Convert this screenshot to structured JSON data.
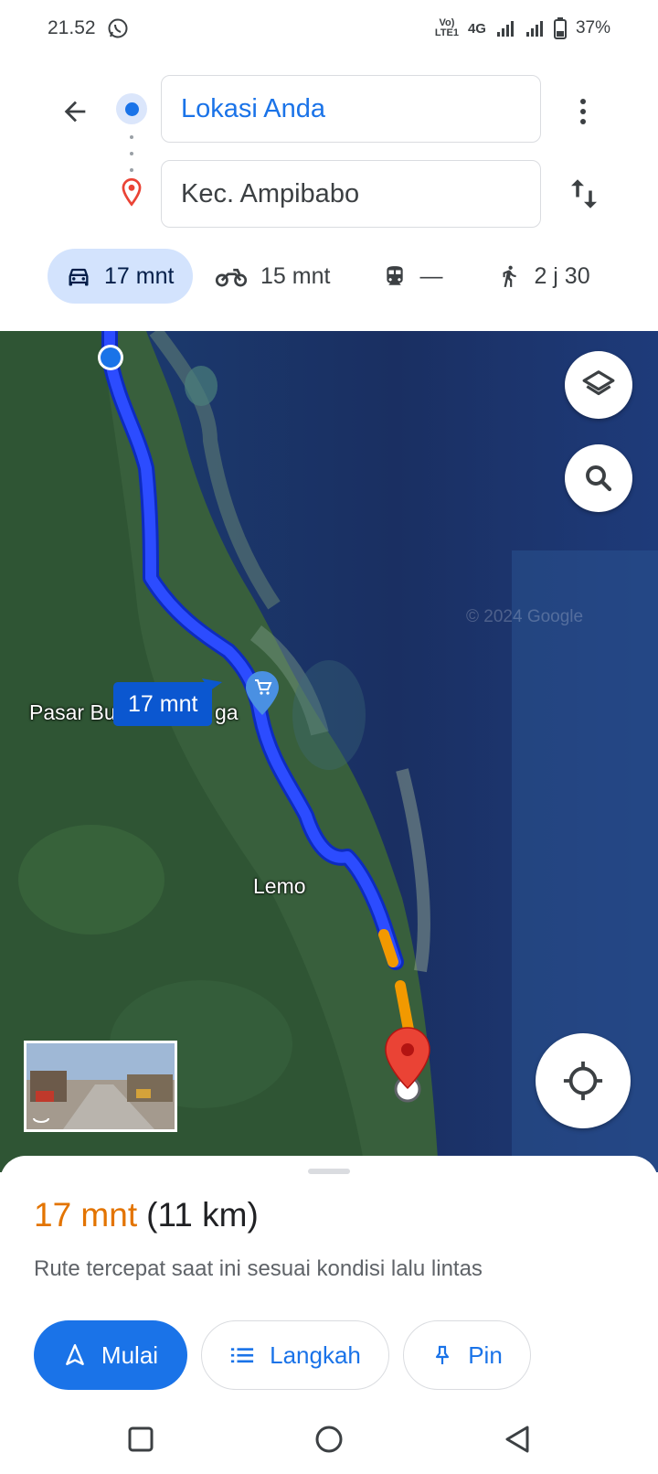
{
  "status_bar": {
    "time": "21.52",
    "network_label_top": "Vo)",
    "network_label_bottom": "LTE1",
    "network_type": "4G",
    "battery_percent": "37%"
  },
  "header": {
    "origin_value": "Lokasi Anda",
    "destination_value": "Kec. Ampibabo"
  },
  "modes": [
    {
      "name": "car",
      "label": "17 mnt",
      "active": true
    },
    {
      "name": "motorcycle",
      "label": "15 mnt",
      "active": false
    },
    {
      "name": "transit",
      "label": "—",
      "active": false
    },
    {
      "name": "walk",
      "label": "2 j 30",
      "active": false
    }
  ],
  "map": {
    "route_badge": "17 mnt",
    "place_label_left": "Pasar Bu",
    "place_label_right": "ga",
    "place_label_lemo": "Lemo",
    "copyright": "© 2024 Google"
  },
  "sheet": {
    "duration": "17 mnt",
    "distance": "(11 km)",
    "description": "Rute tercepat saat ini sesuai kondisi lalu lintas",
    "start_label": "Mulai",
    "steps_label": "Langkah",
    "pin_label": "Pin"
  },
  "colors": {
    "accent": "#1a73e8",
    "route_blue": "#1a3cff",
    "traffic_orange": "#f29900",
    "duration_orange": "#e37400",
    "active_mode_bg": "#d3e3fd",
    "destination_red": "#ea4335"
  }
}
